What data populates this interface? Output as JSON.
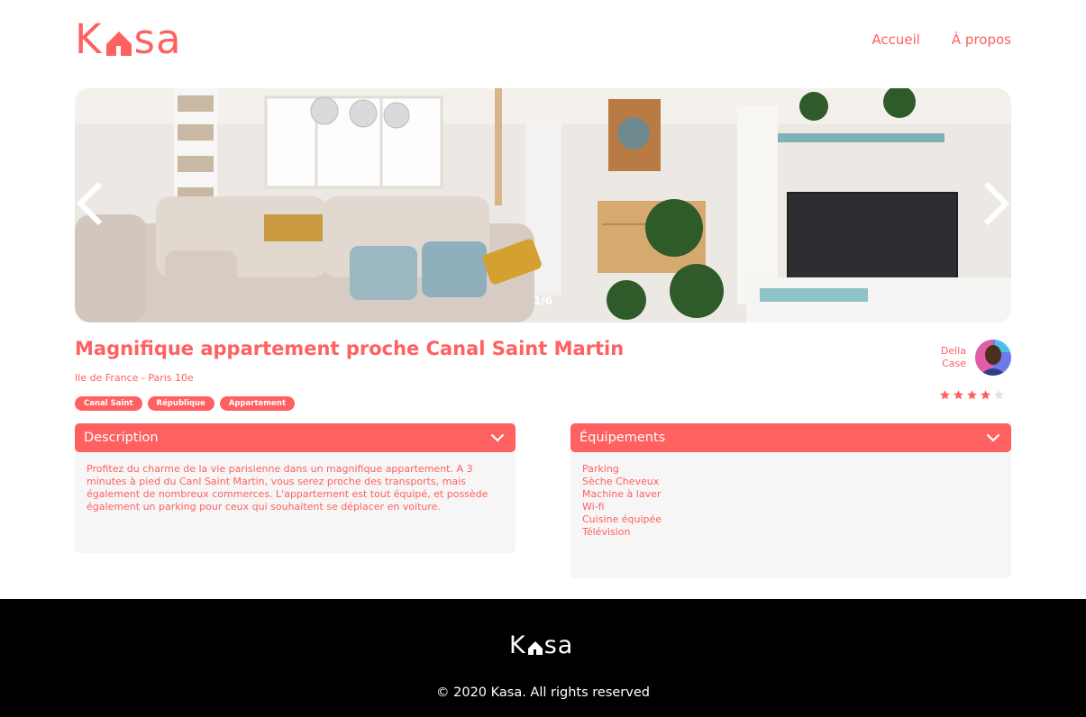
{
  "brand": {
    "logo_k": "K",
    "logo_rest": "sa",
    "color": "#FF6060"
  },
  "nav": {
    "items": [
      {
        "label": "Accueil"
      },
      {
        "label": "À propos"
      }
    ]
  },
  "carousel": {
    "counter": "1/6"
  },
  "listing": {
    "title": "Magnifique appartement proche Canal Saint Martin",
    "location": "Ile de France - Paris 10e",
    "tags": [
      "Canal Saint",
      "République",
      "Appartement"
    ],
    "host": {
      "first_name": "Della",
      "last_name": "Case"
    },
    "rating": 4,
    "rating_max": 5
  },
  "description": {
    "title": "Description",
    "text": "Profitez du charme de la vie parisienne dans un magnifique appartement. A 3 minutes à pied du Canl Saint Martin, vous serez proche des transports, mais également de nombreux commerces. L'appartement est tout équipé, et possède également un parking pour ceux qui souhaitent se déplacer en voiture."
  },
  "equipments": {
    "title": "Équipements",
    "items": [
      "Parking",
      "Sèche Cheveux",
      "Machine à laver",
      "Wi-fi",
      "Cuisine équipée",
      "Télévision"
    ]
  },
  "footer": {
    "copyright": "© 2020 Kasa. All rights reserved"
  }
}
